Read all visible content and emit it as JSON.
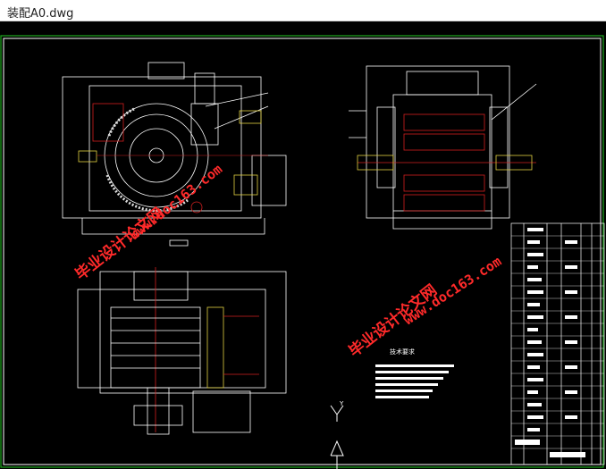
{
  "window": {
    "title": "装配A0.dwg"
  },
  "colors": {
    "background": "#000000",
    "frame": "#1faa1f",
    "line": "#ffffff",
    "accent_red": "#d22020",
    "accent_yellow": "#e0d040",
    "accent_cyan": "#30c0d0",
    "watermark": "#ff2a2a"
  },
  "drawing": {
    "notes_heading": "技术要求",
    "watermarks": [
      {
        "text": "毕业设计论文网"
      },
      {
        "text": "www.doc163.com"
      },
      {
        "text": "毕业设计论文网"
      },
      {
        "text": "www.doc163.com"
      }
    ],
    "ucs_icon_label": "Y"
  }
}
